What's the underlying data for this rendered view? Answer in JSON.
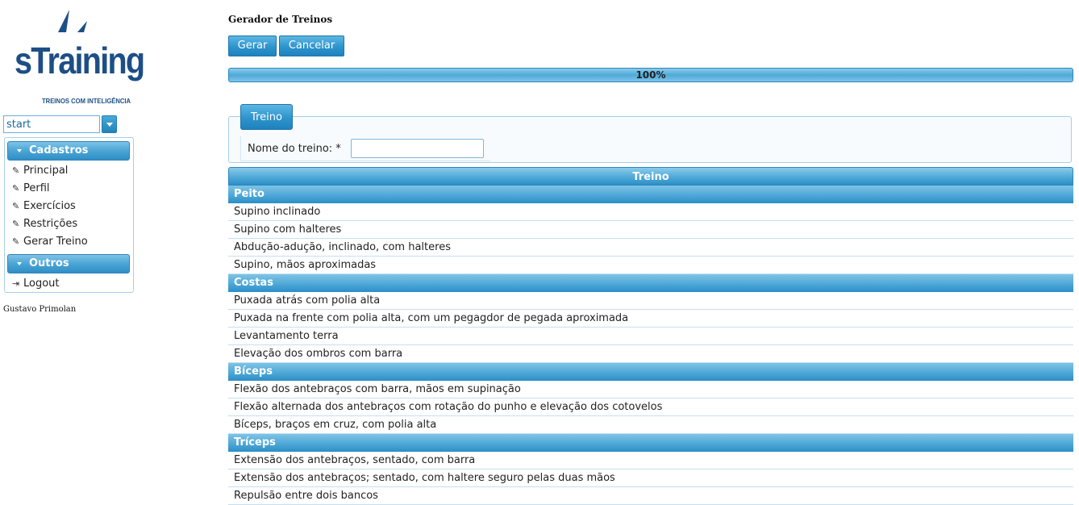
{
  "logo": {
    "wordmark": "sTraining",
    "tagline": "TREINOS COM INTELIGÊNCIA"
  },
  "combo": {
    "value": "start"
  },
  "menu": {
    "groups": [
      {
        "label": "Cadastros",
        "items": [
          "Principal",
          "Perfil",
          "Exercícios",
          "Restrições",
          "Gerar Treino"
        ]
      },
      {
        "label": "Outros",
        "items": [
          "Logout"
        ]
      }
    ]
  },
  "author": "Gustavo Primolan",
  "page": {
    "title": "Gerador de Treinos"
  },
  "toolbar": {
    "generate_label": "Gerar",
    "cancel_label": "Cancelar"
  },
  "progress": {
    "label": "100%",
    "value": 1.0
  },
  "form": {
    "legend": "Treino",
    "name_label": "Nome do treino: *",
    "name_value": ""
  },
  "table": {
    "title": "Treino",
    "groups": [
      {
        "name": "Peito",
        "items": [
          "Supino inclinado",
          "Supino com halteres",
          "Abdução-adução, inclinado, com halteres",
          "Supino, mãos aproximadas"
        ]
      },
      {
        "name": "Costas",
        "items": [
          "Puxada atrás com polia alta",
          "Puxada na frente com polia alta, com um pegagdor de pegada aproximada",
          "Levantamento terra",
          "Elevação dos ombros com barra"
        ]
      },
      {
        "name": "Bíceps",
        "items": [
          "Flexão dos antebraços com barra, mãos em supinação",
          "Flexão alternada dos antebraços com rotação do punho e elevação dos cotovelos",
          "Bíceps, braços em cruz, com polia alta"
        ]
      },
      {
        "name": "Tríceps",
        "items": [
          "Extensão dos antebraços, sentado, com barra",
          "Extensão dos antebraços; sentado, com haltere seguro pelas duas mãos",
          "Repulsão entre dois bancos"
        ]
      }
    ]
  },
  "colors": {
    "brand": "#1d4e86",
    "accent": "#2e94cc"
  }
}
